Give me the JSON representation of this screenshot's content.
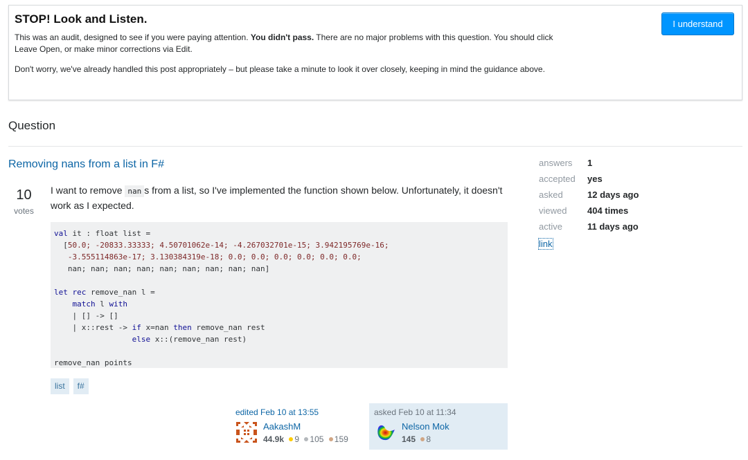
{
  "audit": {
    "title": "STOP! Look and Listen.",
    "p1_a": "This was an audit, designed to see if you were paying attention. ",
    "p1_bold": "You didn't pass.",
    "p1_b": " There are no major problems with this question. You should click Leave Open, or make minor corrections via Edit.",
    "p2": "Don't worry, we've already handled this post appropriately – but please take a minute to look it over closely, keeping in mind the guidance above.",
    "button_label": "I understand",
    "button_color": "#0095ff"
  },
  "section": {
    "title": "Question"
  },
  "question": {
    "title": "Removing nans from a list in F#",
    "votes": "10",
    "votes_label": "votes",
    "body_a": "I want to remove ",
    "body_code": "nan",
    "body_b": "s from a list, so I've implemented the function shown below. Unfortunately, it doesn't work as I expected.",
    "code": {
      "l1_kw": "val",
      "l1_rest": " it : float list =",
      "l2_a": "  [",
      "l2_lit": "50.0; -20833.33333; 4.50701062e-14; -4.267032701e-15; 3.942195769e-16;",
      "l3_lit": "   -3.555114863e-17; 3.130384319e-18; 0.0; 0.0; 0.0; 0.0; 0.0; 0.0;",
      "l4": "   nan; nan; nan; nan; nan; nan; nan; nan; nan]",
      "l6_kw": "let rec",
      "l6_rest": " remove_nan l =",
      "l7_a": "    ",
      "l7_kw1": "match",
      "l7_b": " l ",
      "l7_kw2": "with",
      "l8": "    | [] -> []",
      "l9_a": "    | x::rest -> ",
      "l9_kw1": "if",
      "l9_b": " x=nan ",
      "l9_kw2": "then",
      "l9_c": " remove_nan rest",
      "l10_a": "                 ",
      "l10_kw": "else",
      "l10_b": " x::(remove_nan rest)",
      "l12": "remove_nan points"
    },
    "tags": [
      "list",
      "f#"
    ]
  },
  "editor": {
    "action": "edited Feb 10 at 13:55",
    "name": "AakashM",
    "reputation": "44.9k",
    "gold": "9",
    "silver": "105",
    "bronze": "159"
  },
  "owner": {
    "action": "asked Feb 10 at 11:34",
    "name": "Nelson Mok",
    "reputation": "145",
    "bronze": "8"
  },
  "stats": {
    "rows": [
      {
        "key": "answers",
        "value": "1"
      },
      {
        "key": "accepted",
        "value": "yes"
      },
      {
        "key": "asked",
        "value": "12 days ago"
      },
      {
        "key": "viewed",
        "value": "404 times"
      },
      {
        "key": "active",
        "value": "11 days ago"
      }
    ],
    "link_label": "link"
  },
  "colors": {
    "link": "#0c65a5",
    "tag_bg": "#e1ecf4",
    "gold": "#ffcc01",
    "silver": "#b4b8bc",
    "bronze": "#d1a684"
  }
}
